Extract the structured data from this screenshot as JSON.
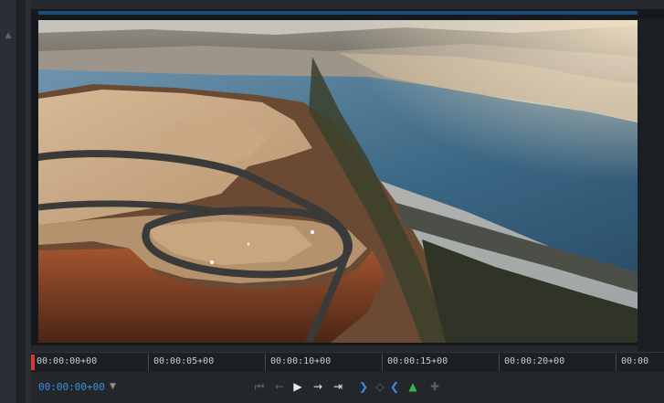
{
  "timecode": {
    "current": "00:00:00+00",
    "dropdown_icon": "chevron-down-icon"
  },
  "ruler": {
    "ticks": [
      "00:00:00+00",
      "00:00:05+00",
      "00:00:10+00",
      "00:00:15+00",
      "00:00:20+00",
      "00:00"
    ]
  },
  "transport": {
    "controls": [
      {
        "name": "go-to-start-icon",
        "state": "disabled"
      },
      {
        "name": "step-back-icon",
        "state": "disabled"
      },
      {
        "name": "play-icon",
        "state": "enabled"
      },
      {
        "name": "step-forward-icon",
        "state": "enabled"
      },
      {
        "name": "go-to-end-icon",
        "state": "enabled"
      },
      {
        "name": "mark-in-icon",
        "state": "enabled"
      },
      {
        "name": "add-marker-icon",
        "state": "disabled"
      },
      {
        "name": "mark-out-icon",
        "state": "enabled"
      },
      {
        "name": "export-frame-icon",
        "state": "enabled"
      },
      {
        "name": "add-keyframe-icon",
        "state": "disabled"
      }
    ]
  },
  "colors": {
    "accent": "#3d8ee0",
    "playhead": "#d33b2e",
    "panel": "#23272c"
  }
}
